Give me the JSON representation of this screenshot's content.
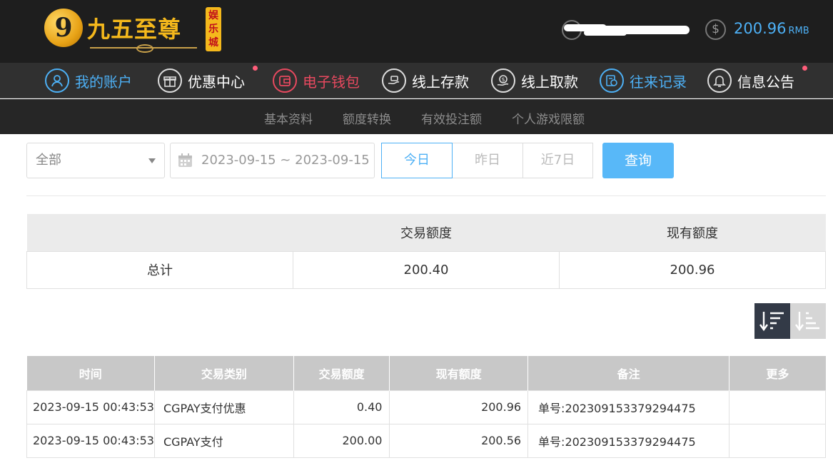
{
  "header": {
    "logo_mark": "9",
    "logo_text": "九五至尊",
    "logo_tag": "娱乐城",
    "balance": "200.96",
    "balance_unit": "RMB"
  },
  "nav": [
    {
      "label": "我的账户",
      "icon": "user-icon",
      "state": "blue"
    },
    {
      "label": "优惠中心",
      "icon": "gift-icon",
      "dot": true
    },
    {
      "label": "电子钱包",
      "icon": "wallet-icon",
      "state": "red"
    },
    {
      "label": "线上存款",
      "icon": "deposit-icon"
    },
    {
      "label": "线上取款",
      "icon": "withdraw-icon"
    },
    {
      "label": "往来记录",
      "icon": "records-icon",
      "state": "blue"
    },
    {
      "label": "信息公告",
      "icon": "bell-icon",
      "dot": true
    }
  ],
  "subnav": [
    "基本资料",
    "额度转换",
    "有效投注额",
    "个人游戏限额"
  ],
  "filter": {
    "category_selected": "全部",
    "date_range": "2023-09-15 ~ 2023-09-15",
    "quick_ranges": [
      "今日",
      "昨日",
      "近7日"
    ],
    "active_range": "今日",
    "query_label": "查询"
  },
  "summary": {
    "headers": [
      "",
      "交易额度",
      "现有额度"
    ],
    "row": [
      "总计",
      "200.40",
      "200.96"
    ]
  },
  "sort": {
    "desc_icon": "sort-desc-icon",
    "asc_icon": "sort-asc-icon"
  },
  "detail": {
    "headers": [
      "时间",
      "交易类别",
      "交易额度",
      "现有额度",
      "备注",
      "更多"
    ],
    "rows": [
      [
        "2023-09-15 00:43:53",
        "CGPAY支付优惠",
        "0.40",
        "200.96",
        "单号:202309153379294475",
        ""
      ],
      [
        "2023-09-15 00:43:53",
        "CGPAY支付",
        "200.00",
        "200.56",
        "单号:202309153379294475",
        ""
      ]
    ]
  },
  "colors": {
    "accent_blue": "#4db0f5",
    "accent_red": "#e8495f",
    "header_bg": "#1e1e1e",
    "nav_bg": "#303030",
    "gold": "#f4b81c"
  }
}
